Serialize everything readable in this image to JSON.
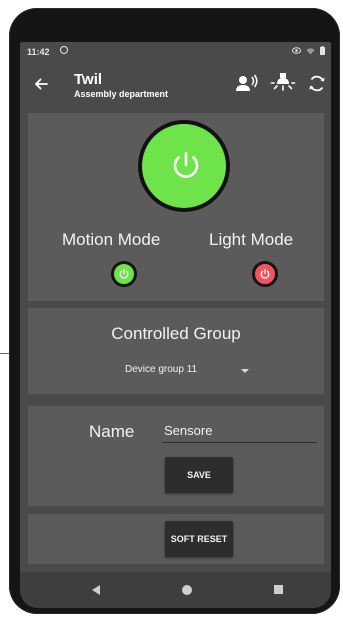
{
  "status_bar": {
    "time": "11:42",
    "icons": [
      "app-notification-icon",
      "eye-icon",
      "wifi-icon",
      "battery-icon"
    ]
  },
  "app_bar": {
    "title": "Twil",
    "subtitle": "Assembly department",
    "icons": [
      "back-arrow-icon",
      "voice-icon",
      "light-bulb-icon",
      "refresh-icon"
    ]
  },
  "main_control": {
    "power_state": "on",
    "power_color": "#6fe34a",
    "motion_mode_label": "Motion Mode",
    "motion_mode_state": "on",
    "motion_mode_color": "#6fe34a",
    "light_mode_label": "Light Mode",
    "light_mode_state": "off",
    "light_mode_color": "#f2545f"
  },
  "controlled_group": {
    "title": "Controlled Group",
    "selected": "Device group 11"
  },
  "name_section": {
    "label": "Name",
    "value": "Sensore",
    "save_label": "SAVE"
  },
  "reset": {
    "label": "SOFT RESET"
  },
  "nav_bar": {
    "icons": [
      "nav-back-icon",
      "nav-home-icon",
      "nav-recents-icon"
    ]
  }
}
